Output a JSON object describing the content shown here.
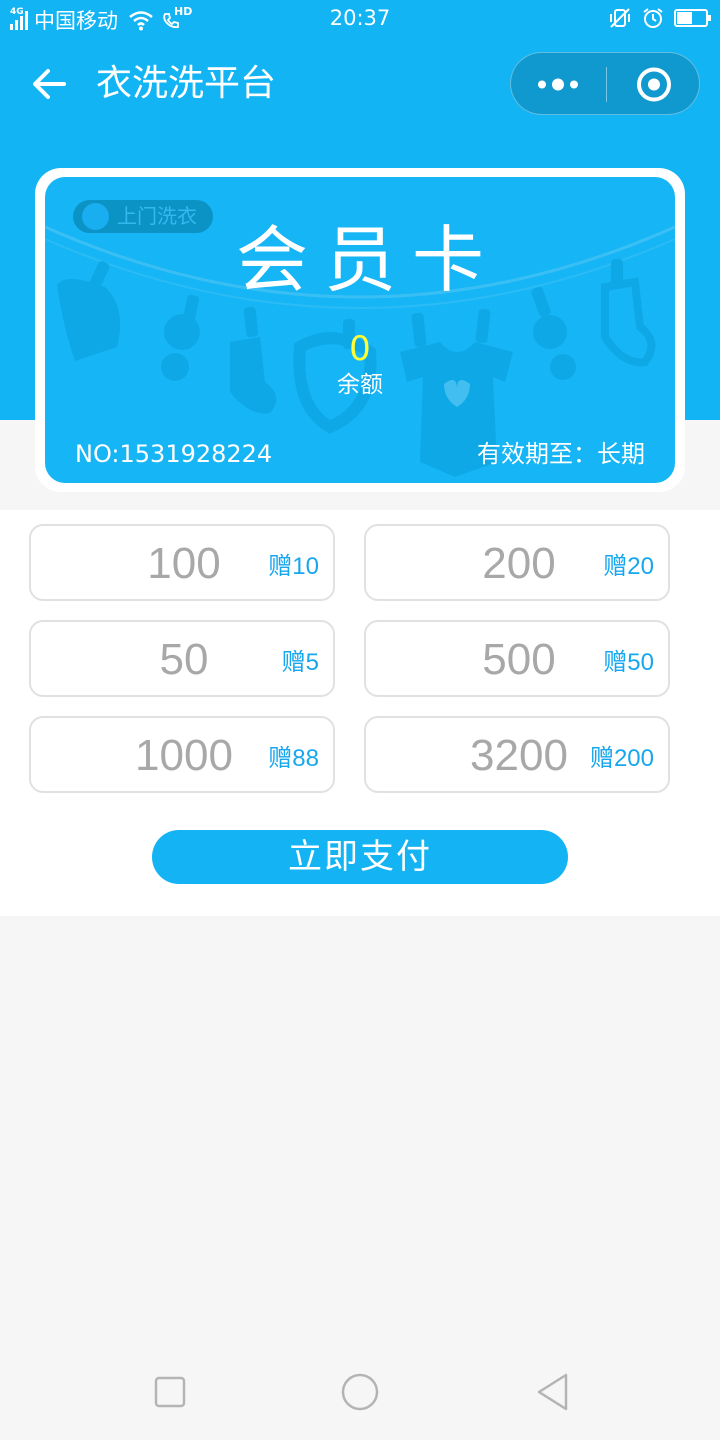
{
  "status_bar": {
    "network_type": "4G",
    "carrier": "中国移动",
    "hd_label": "HD",
    "time": "20:37",
    "battery_level": 0.55
  },
  "nav": {
    "title": "衣洗洗平台"
  },
  "card": {
    "tag": "上门洗衣",
    "title": "会员卡",
    "balance_value": "0",
    "balance_label": "余额",
    "card_no": "NO:1531928224",
    "validity": "有效期至：长期"
  },
  "options": [
    {
      "amount": "100",
      "bonus": "赠10"
    },
    {
      "amount": "200",
      "bonus": "赠20"
    },
    {
      "amount": "50",
      "bonus": "赠5"
    },
    {
      "amount": "500",
      "bonus": "赠50"
    },
    {
      "amount": "1000",
      "bonus": "赠88"
    },
    {
      "amount": "3200",
      "bonus": "赠200"
    }
  ],
  "pay_button": "立即支付",
  "colors": {
    "primary": "#12b4f4",
    "balance": "#ffff33",
    "bonus_text": "#17a7ee",
    "amount_text": "#a8a8a8"
  }
}
